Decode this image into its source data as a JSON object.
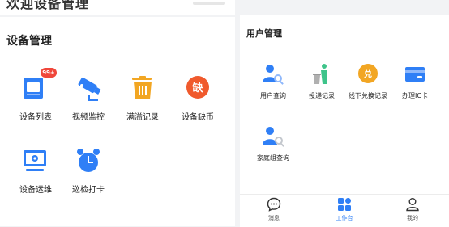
{
  "left": {
    "top_title": "欢迎设备管理",
    "section_title": "设备管理",
    "items": [
      {
        "label": "设备列表",
        "badge": "99+"
      },
      {
        "label": "视频监控"
      },
      {
        "label": "满溢记录"
      },
      {
        "label": "设备缺币",
        "glyph": "缺"
      },
      {
        "label": "设备运维"
      },
      {
        "label": "巡检打卡"
      }
    ]
  },
  "right": {
    "section_title": "用户管理",
    "items": [
      {
        "label": "用户查询"
      },
      {
        "label": "投递记录"
      },
      {
        "label": "线下兑换记录",
        "glyph": "兑"
      },
      {
        "label": "办理IC卡"
      },
      {
        "label": "家庭组查询"
      }
    ]
  },
  "tabbar": {
    "tabs": [
      {
        "label": "消息"
      },
      {
        "label": "工作台"
      },
      {
        "label": "我的"
      }
    ],
    "active_index": 1
  },
  "colors": {
    "primary": "#2f7ff6",
    "orange": "#f2a623",
    "red_orange": "#f05a2d",
    "green": "#3ec48a",
    "badge_red": "#f0473b"
  }
}
